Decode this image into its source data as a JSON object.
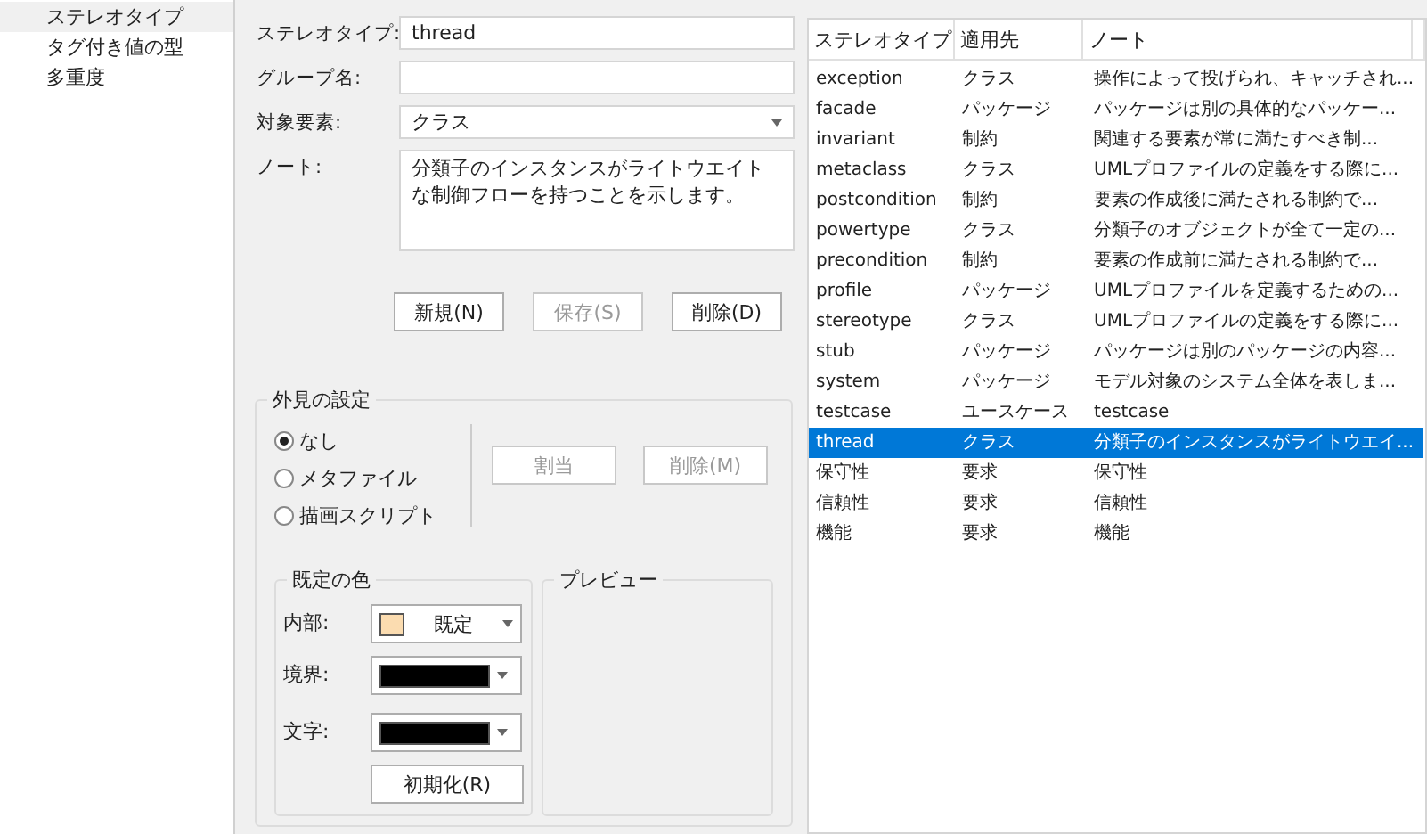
{
  "sidebar": {
    "items": [
      {
        "label": "ステレオタイプ",
        "selected": true
      },
      {
        "label": "タグ付き値の型",
        "selected": false
      },
      {
        "label": "多重度",
        "selected": false
      }
    ]
  },
  "form": {
    "fields": [
      {
        "kind": "text",
        "label": "ステレオタイプ:",
        "value": "thread"
      },
      {
        "kind": "text",
        "label": "グループ名:"
      },
      {
        "kind": "select",
        "label": "対象要素:",
        "value": "クラス"
      },
      {
        "kind": "note",
        "label": "ノート:",
        "value": "分類子のインスタンスがライトウエイトな制御フローを持つことを示します。"
      }
    ],
    "buttons": [
      {
        "label": "新規(N)",
        "disabled": false
      },
      {
        "label": "保存(S)",
        "disabled": true
      },
      {
        "label": "削除(D)",
        "disabled": false
      }
    ]
  },
  "appearance": {
    "title": "外見の設定",
    "options": [
      {
        "label": "なし",
        "selected": true
      },
      {
        "label": "メタファイル",
        "selected": false
      },
      {
        "label": "描画スクリプト",
        "selected": false
      }
    ],
    "buttons": [
      {
        "label": "割当",
        "disabled": true
      },
      {
        "label": "削除(M)",
        "disabled": true
      }
    ],
    "default_colors": {
      "title": "既定の色",
      "rows": [
        {
          "label": "内部:",
          "color": "#fbdcb0",
          "value": "既定"
        },
        {
          "label": "境界:",
          "color": "#000000"
        },
        {
          "label": "文字:",
          "color": "#000000"
        }
      ],
      "reset_button": "初期化(R)"
    },
    "preview": {
      "title": "プレビュー"
    }
  },
  "table": {
    "columns": [
      "ステレオタイプ",
      "適用先",
      "ノート"
    ],
    "rows": [
      {
        "cells": [
          "exception",
          "クラス",
          "操作によって投げられ、キャッチされ..."
        ],
        "selected": false
      },
      {
        "cells": [
          "facade",
          "パッケージ",
          "パッケージは別の具体的なパッケー..."
        ],
        "selected": false
      },
      {
        "cells": [
          "invariant",
          "制約",
          "関連する要素が常に満たすべき制..."
        ],
        "selected": false
      },
      {
        "cells": [
          "metaclass",
          "クラス",
          "UMLプロファイルの定義をする際に..."
        ],
        "selected": false
      },
      {
        "cells": [
          "postcondition",
          "制約",
          "要素の作成後に満たされる制約で..."
        ],
        "selected": false
      },
      {
        "cells": [
          "powertype",
          "クラス",
          "分類子のオブジェクトが全て一定の..."
        ],
        "selected": false
      },
      {
        "cells": [
          "precondition",
          "制約",
          "要素の作成前に満たされる制約で..."
        ],
        "selected": false
      },
      {
        "cells": [
          "profile",
          "パッケージ",
          "UMLプロファイルを定義するための..."
        ],
        "selected": false
      },
      {
        "cells": [
          "stereotype",
          "クラス",
          "UMLプロファイルの定義をする際に..."
        ],
        "selected": false
      },
      {
        "cells": [
          "stub",
          "パッケージ",
          "パッケージは別のパッケージの内容..."
        ],
        "selected": false
      },
      {
        "cells": [
          "system",
          "パッケージ",
          "モデル対象のシステム全体を表しま..."
        ],
        "selected": false
      },
      {
        "cells": [
          "testcase",
          "ユースケース",
          "testcase"
        ],
        "selected": false
      },
      {
        "cells": [
          "thread",
          "クラス",
          "分類子のインスタンスがライトウエイ..."
        ],
        "selected": true
      },
      {
        "cells": [
          "保守性",
          "要求",
          "保守性"
        ],
        "selected": false
      },
      {
        "cells": [
          "信頼性",
          "要求",
          "信頼性"
        ],
        "selected": false
      },
      {
        "cells": [
          "機能",
          "要求",
          "機能"
        ],
        "selected": false
      }
    ]
  }
}
